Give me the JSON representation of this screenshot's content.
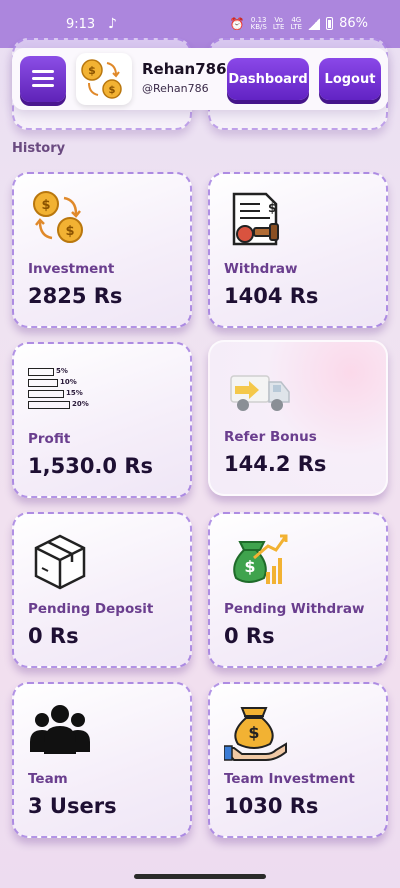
{
  "status_bar": {
    "time": "9:13",
    "net_speed": "0.13",
    "net_unit": "KB/S",
    "net_type_1": "Vo",
    "net_type_1b": "LTE",
    "net_type_2": "4G",
    "net_type_2b": "LTE",
    "battery": "86%"
  },
  "header": {
    "username": "Rehan786",
    "handle": "@Rehan786",
    "dashboard_label": "Dashboard",
    "logout_label": "Logout"
  },
  "section_title": "History",
  "cards": [
    {
      "label": "Investment",
      "value": "2825 Rs"
    },
    {
      "label": "Withdraw",
      "value": "1404 Rs"
    },
    {
      "label": "Profit",
      "value": "1,530.0 Rs"
    },
    {
      "label": "Refer Bonus",
      "value": "144.2 Rs"
    },
    {
      "label": "Pending Deposit",
      "value": "0 Rs"
    },
    {
      "label": "Pending Withdraw",
      "value": "0 Rs"
    },
    {
      "label": "Team",
      "value": "3 Users"
    },
    {
      "label": "Team Investment",
      "value": "1030 Rs"
    }
  ],
  "profit_icon_levels": [
    "5%",
    "10%",
    "15%",
    "20%"
  ],
  "icons": {
    "investment": "coins-exchange-icon",
    "withdraw": "contract-stamp-icon",
    "profit": "percentage-bars-icon",
    "refer_bonus": "delivery-truck-icon",
    "pending_deposit": "package-box-icon",
    "pending_withdraw": "money-bag-growth-icon",
    "team": "team-people-icon",
    "team_investment": "money-bag-hand-icon"
  },
  "colors": {
    "status_bar": "#ac86dd",
    "accent": "#6a2ccc",
    "label": "#6a3e8e",
    "value": "#1e0f33"
  }
}
